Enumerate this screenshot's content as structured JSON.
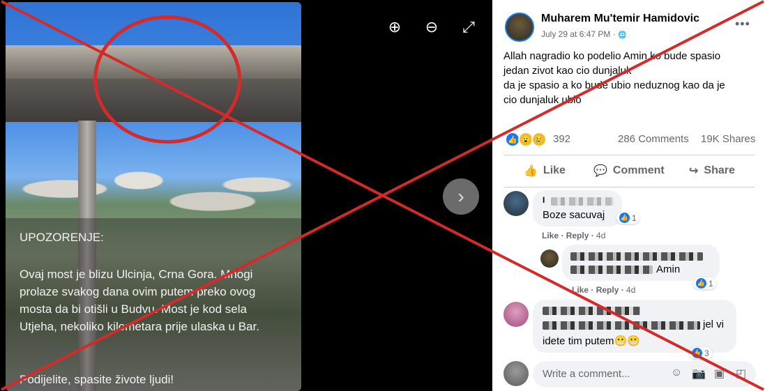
{
  "viewer": {
    "zoom_in_icon": "⊕",
    "zoom_out_icon": "⊖",
    "fullscreen_icon": "⤢",
    "next_icon": "›",
    "image_text": {
      "title": "UPOZORENJE:",
      "body": "Ovaj most je blizu Ulcinja, Crna Gora. Mnogi prolaze svakog dana ovim putem preko ovog mosta da bi otišli u Budvu. Most je kod sela Utjeha, nekoliko kilometara prije ulaska u Bar.",
      "footer": "Podijelite, spasite živote ljudi!"
    }
  },
  "post": {
    "author": "Muharem Mu'temir Hamidovic",
    "date": "July 29 at 6:47 PM · ",
    "globe_icon": "🌐",
    "more_icon": "•••",
    "text_lines": [
      "Allah nagradio ko podelio Amin ko bude spasio",
      "jedan zivot kao cio dunjaluk",
      "da je spasio a ko bude ubio neduznog kao da je",
      "cio dunjaluk ubio"
    ],
    "reaction_count": "392",
    "comments_count": "286 Comments",
    "shares_count": "19K Shares",
    "actions": {
      "like": "Like",
      "comment": "Comment",
      "share": "Share"
    }
  },
  "comments": [
    {
      "name": "I",
      "text": "Boze sacuvaj",
      "likes": "1",
      "meta_like": "Like",
      "meta_reply": "Reply",
      "time": "4d"
    },
    {
      "text": "Amin",
      "likes": "1",
      "meta_like": "Like",
      "meta_reply": "Reply",
      "time": "4d"
    },
    {
      "text_tail": "jel vi",
      "text_line2": "idete tim putem😬😬",
      "likes": "3"
    }
  ],
  "composer": {
    "placeholder": "Write a comment..."
  },
  "colors": {
    "cross": "#d42a2a",
    "facebook_blue": "#1877f2"
  }
}
